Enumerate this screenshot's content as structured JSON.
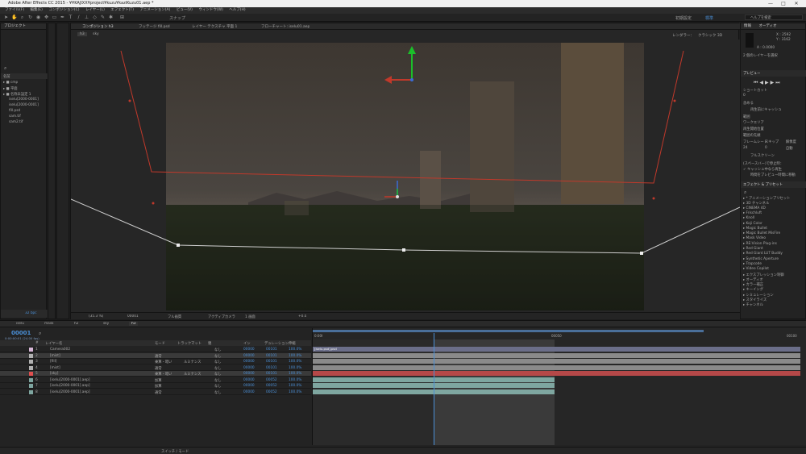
{
  "app": {
    "title": "Adobe After Effects CC 2015 - ¥¥KAJIXX¥project¥kuzu¥kaziKuzu01.aep *",
    "window_controls": [
      "—",
      "□",
      "✕"
    ]
  },
  "menu": [
    "ファイル(F)",
    "編集(E)",
    "コンポジション(C)",
    "レイヤー(L)",
    "エフェクト(T)",
    "アニメーション(A)",
    "ビュー(V)",
    "ウィンドウ(W)",
    "ヘルプ(H)"
  ],
  "toolbar": {
    "snap_label": "スナップ",
    "workspace": "初期設定",
    "standard": "標準",
    "search_placeholder": "ヘルプを検索"
  },
  "project_panel": {
    "tab": "プロジェクト",
    "columns": {
      "name": "名前"
    },
    "items": [
      "cmp",
      "平面",
      "名称未設定 1",
      "iselu[2000-0001]",
      "iselu[2000-0001]",
      "fill.psd",
      "sam.tif",
      "sam2.tif"
    ],
    "bpc": "32 bpc"
  },
  "composition": {
    "tabs": [
      "コンポジション h3",
      "フッテージ fill.psd",
      "レイヤー テクスチャ 平面 1",
      "フローチャート: iselu01.aep"
    ],
    "breadcrumb": [
      "h3",
      "sky"
    ],
    "view_label": "アクティブカメラ",
    "renderer_label": "レンダラー：",
    "renderer_value": "クラシック 3D",
    "zoom": "(35.3 %)",
    "frame": "00001",
    "resolution": "フル画質",
    "camera": "アクティブカメラ",
    "views": "1 画面",
    "plus": "+0.0"
  },
  "info_panel": {
    "tabs": [
      "情報",
      "オーディオ"
    ],
    "x": "X : 2592",
    "y": "Y : 3162",
    "alpha": "A : 0.0000",
    "layer_hint": "2 個のレイヤーを選択"
  },
  "preview_panel": {
    "title": "プレビュー",
    "shortcut_label": "ショートカット",
    "shortcut_value": "0",
    "include_label": "含める",
    "cache_label": "再生前にキャッシュ",
    "media_label": "範囲",
    "media_value": "ワークエリア",
    "play_from_label": "再生開始位置",
    "play_from_value": "範囲の先頭",
    "frame_rate_label": "フレームレート",
    "skip_label": "スキップ",
    "res_label": "解像度",
    "frame_rate_value": "24",
    "skip_value": "0",
    "res_value": "自動",
    "fullscreen": "フルスクリーン",
    "stop_label": "(スペースバー)で停止時：",
    "cache_play": "キャッシュ中なら再生",
    "move_time": "時間をプレビュー時間に移動"
  },
  "effects_panel": {
    "title": "エフェクト & プリセット",
    "items": [
      "* アニメーションプリセット",
      "3D チャンネル",
      "CINEMA 4D",
      "Frischluft",
      "Knoll",
      "Koji Color",
      "Magic Bullet",
      "Magic Bullet MisFire",
      "Mask Video",
      "RE:Vision Plug-ins",
      "Red Giant",
      "Red Giant LUT Buddy",
      "Synthetic Aperture",
      "Trapcode",
      "Video Copilot",
      "エクスプレッション制御",
      "オーディオ",
      "カラー補正",
      "キーイング",
      "シミュレーション",
      "スタイライズ",
      "チャンネル"
    ]
  },
  "timeline": {
    "tabs": [
      "iselu",
      "mask",
      "h2",
      "sky",
      "h3"
    ],
    "timecode": "00001",
    "sub_timecode": "0:00:00:01 (24.00 fps)",
    "headers": {
      "num": "#",
      "layer_name": "レイヤー名",
      "mode": "モード",
      "trkmat": "トラックマット",
      "parent": "親",
      "in": "イン",
      "duration": "デュレーション",
      "stretch": "伸縮"
    },
    "ruler": [
      "0:00f",
      "00050",
      "00100"
    ],
    "work_label": "[iselu.psd].psd",
    "layers": [
      {
        "num": "1",
        "name": "Camera002",
        "mode": "",
        "mat": "",
        "parent": "なし",
        "in": "00000",
        "dur": "00101",
        "str": "100.0%",
        "color": "#d8b8d8"
      },
      {
        "num": "2",
        "name": "[mist]",
        "mode": "通常",
        "mat": "",
        "parent": "なし",
        "in": "00000",
        "dur": "00101",
        "str": "100.0%",
        "color": "#b1b1b1"
      },
      {
        "num": "3",
        "name": "[fill]",
        "mode": "乗算・暗い",
        "mat": "ルミナンス",
        "parent": "なし",
        "in": "00000",
        "dur": "00101",
        "str": "100.0%",
        "color": "#b1b1b1"
      },
      {
        "num": "4",
        "name": "[mist]",
        "mode": "通常",
        "mat": "",
        "parent": "なし",
        "in": "00000",
        "dur": "00101",
        "str": "100.0%",
        "color": "#b1b1b1"
      },
      {
        "num": "5",
        "name": "[sky]",
        "mode": "乗算・暗い",
        "mat": "ルミナンス",
        "parent": "なし",
        "in": "00000",
        "dur": "00101",
        "str": "100.0%",
        "color": "#e05050"
      },
      {
        "num": "6",
        "name": "[iselu[2000-0001].aep]",
        "mode": "加算",
        "mat": "",
        "parent": "なし",
        "in": "00000",
        "dur": "00052",
        "str": "100.0%",
        "color": "#7ea6a0"
      },
      {
        "num": "7",
        "name": "[iselu[2000-0001].aep]",
        "mode": "加算",
        "mat": "",
        "parent": "なし",
        "in": "00000",
        "dur": "00052",
        "str": "100.0%",
        "color": "#7ea6a0"
      },
      {
        "num": "8",
        "name": "[iselu[2000-0001].aep]",
        "mode": "通常",
        "mat": "",
        "parent": "なし",
        "in": "00000",
        "dur": "00052",
        "str": "100.0%",
        "color": "#7ea6a0"
      }
    ],
    "footer": "スイッチ / モード"
  }
}
